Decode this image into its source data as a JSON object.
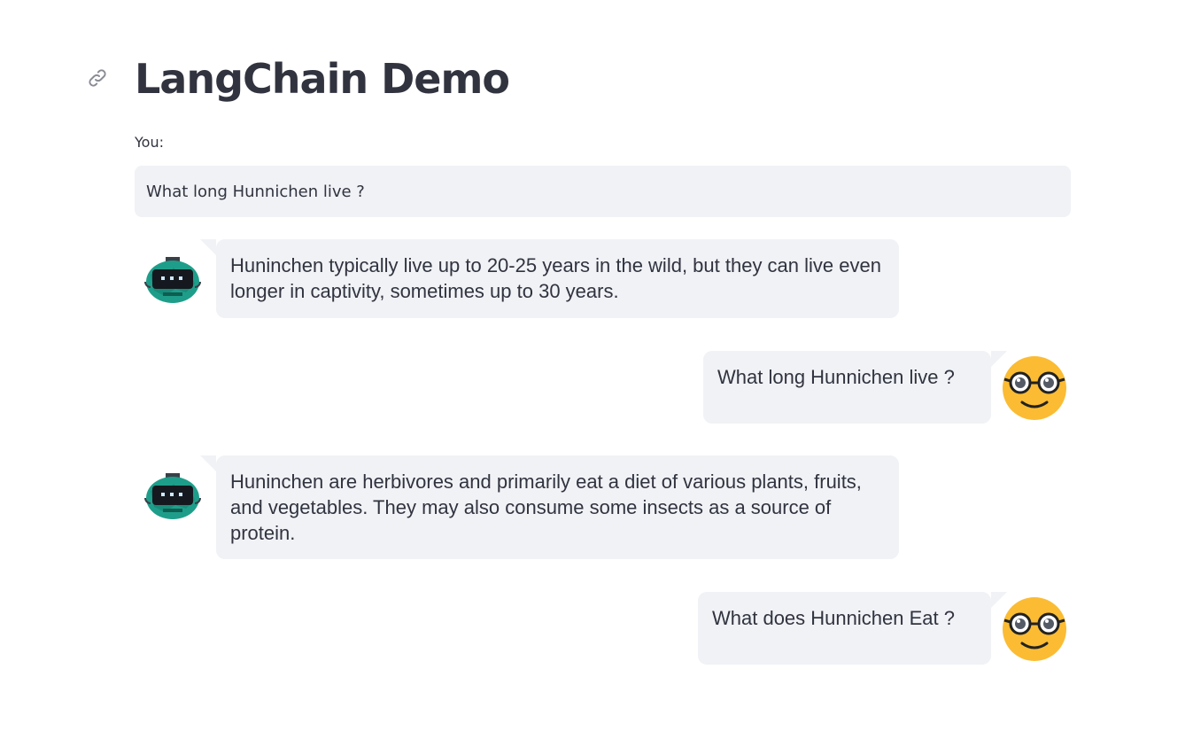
{
  "header": {
    "title": "LangChain Demo",
    "anchor_icon": "link-icon"
  },
  "input": {
    "label": "You:",
    "value": "What long Hunnichen live ?"
  },
  "messages": [
    {
      "role": "bot",
      "avatar": "robot-avatar-icon",
      "text": "Huninchen typically live up to 20-25 years in the wild, but they can live even longer in captivity, sometimes up to 30 years."
    },
    {
      "role": "user",
      "avatar": "nerd-face-avatar-icon",
      "text": "What long Hunnichen live ?"
    },
    {
      "role": "bot",
      "avatar": "robot-avatar-icon",
      "text": "Huninchen are herbivores and primarily eat a diet of various plants, fruits, and vegetables. They may also consume some insects as a source of protein."
    },
    {
      "role": "user",
      "avatar": "nerd-face-avatar-icon",
      "text": "What does Hunnichen Eat ?"
    }
  ],
  "colors": {
    "bubble_bg": "#f0f2f6",
    "text": "#31333f",
    "robot_teal": "#1e9e8a",
    "nerd_yellow": "#fbbc33"
  }
}
